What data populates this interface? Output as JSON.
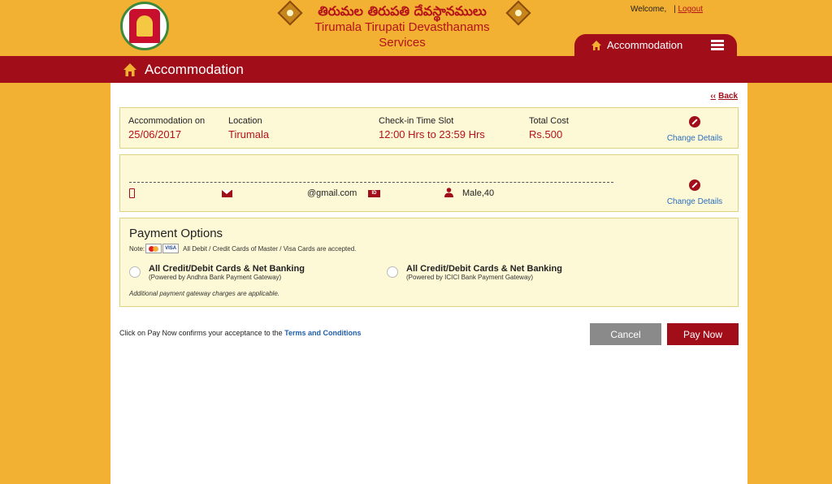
{
  "header": {
    "telugu_title": "తిరుమల తిరుపతి దేవస్థానములు",
    "title_line1": "Tirumala Tirupati Devasthanams",
    "title_line2": "Services",
    "welcome_label": "Welcome,",
    "user_name": "",
    "logout_label": "Logout",
    "accommodation_tab": "Accommodation"
  },
  "page": {
    "title": "Accommodation",
    "back_label": "Back"
  },
  "booking": {
    "date_label": "Accommodation on",
    "date_value": "25/06/2017",
    "location_label": "Location",
    "location_value": "Tirumala",
    "slot_label": "Check-in Time Slot",
    "slot_value": "12:00 Hrs to 23:59 Hrs",
    "cost_label": "Total Cost",
    "cost_value": "Rs.500",
    "change_label": "Change Details"
  },
  "pilgrim": {
    "email": "@gmail.com",
    "gender_age": "Male,40",
    "id_badge": "ID",
    "change_label": "Change Details"
  },
  "payment": {
    "title": "Payment Options",
    "note_prefix": "Note:",
    "note_text": "All Debit / Credit Cards of Master / Visa Cards are accepted.",
    "visa_label": "VISA",
    "option1_main": "All Credit/Debit Cards & Net Banking",
    "option1_sub": "(Powered by Andhra Bank Payment Gateway)",
    "option2_main": "All Credit/Debit Cards & Net Banking",
    "option2_sub": "(Powered by ICICI Bank Payment Gateway)",
    "gateway_note": "Additional payment gateway charges are applicable."
  },
  "footer": {
    "terms_prefix": "Click on Pay Now confirms your acceptance to the",
    "terms_link": "Terms and Conditions",
    "cancel_label": "Cancel",
    "pay_label": "Pay Now"
  },
  "colors": {
    "background": "#f2b132",
    "brand_red": "#a10e1a",
    "info_box": "#fdf8d5",
    "link_blue": "#2a6fbf"
  }
}
